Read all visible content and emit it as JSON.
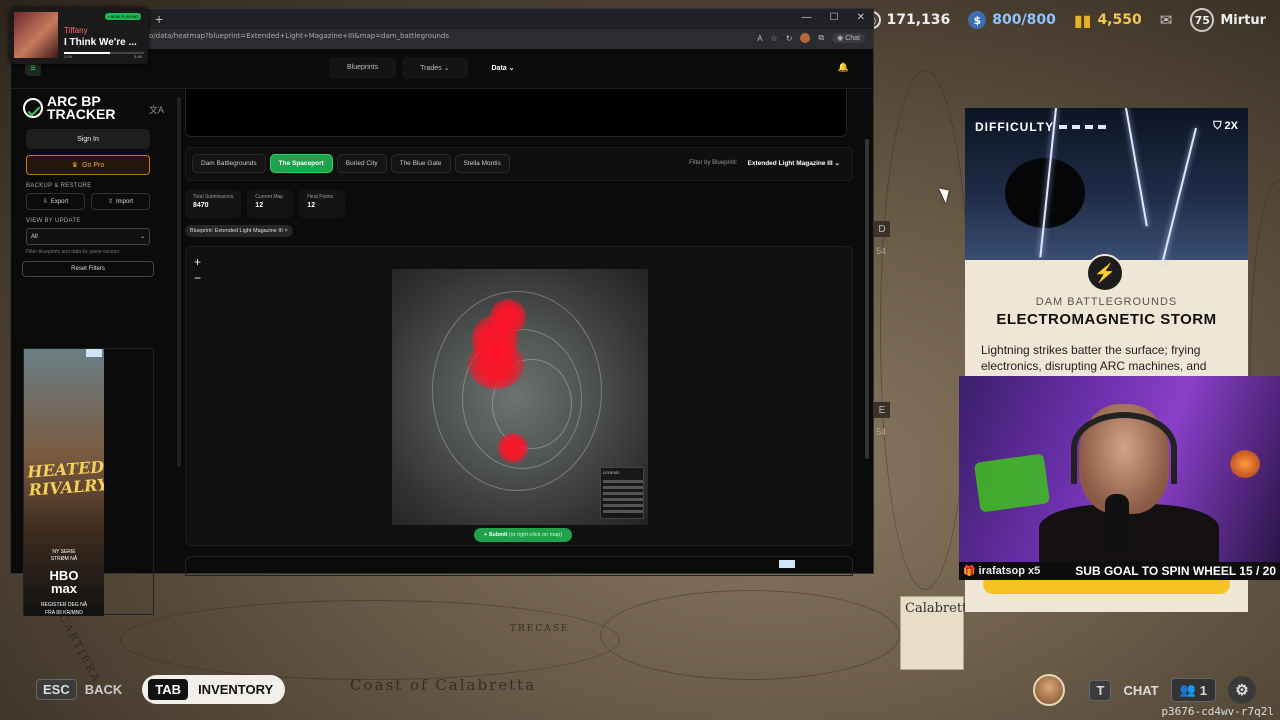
{
  "hud": {
    "currency1": "171,136",
    "currency2": "800/800",
    "currency3": "4,550",
    "level": "75",
    "username": "Mirtur",
    "esc_key": "ESC",
    "back_label": "BACK",
    "tab_key": "TAB",
    "inventory_label": "INVENTORY",
    "chat_key": "T",
    "chat_label": "CHAT",
    "party_count": "1",
    "watermark": "p3676-cd4wv-r7q2l"
  },
  "map_labels": {
    "coast": "Coast of Calabretta",
    "cartiera": "LA CARTIERA",
    "cabin": "TRECASE",
    "calabretta": "Calabretta"
  },
  "side_markers": {
    "d_letter": "D",
    "num1": "54",
    "e_letter": "E",
    "num2": "54"
  },
  "event": {
    "difficulty_label": "DIFFICULTY",
    "multiplier": "2X",
    "map": "DAM BATTLEGROUNDS",
    "title": "ELECTROMAGNETIC STORM",
    "description": "Lightning strikes batter the surface; frying electronics, disrupting ARC machines, and electrocuting unsuspecting Raiders."
  },
  "stream": {
    "gift_text": "irafatsop x5",
    "sub_goal": "SUB GOAL TO SPIN WHEEL 15 / 20"
  },
  "now_playing": {
    "badge": "• NOW PLAYING",
    "artist": "Tiffany",
    "title": "I Think We're ...",
    "elapsed": "2:09",
    "duration": "3:48",
    "progress": 0.57
  },
  "browser": {
    "url": "o/data/heatmap?blueprint=Extended+Light+Magazine+III&map=dam_battlegrounds",
    "chat_label": "Chat",
    "nav": [
      "Blueprints",
      "Trades",
      "Data"
    ],
    "sidebar": {
      "logo_line1": "ARC BP",
      "logo_line2": "TRACKER",
      "sign_in": "Sign In",
      "go_pro": "Go Pro",
      "backup_label": "BACKUP & RESTORE",
      "export": "Export",
      "import": "Import",
      "view_label": "VIEW BY UPDATE",
      "view_value": "All",
      "view_hint": "Filter blueprints and data by game version",
      "reset": "Reset Filters"
    },
    "ad": {
      "title": "HEATED RIVALRY",
      "sub1": "NY SERIE",
      "sub2": "STRØM NÅ",
      "brand1": "HBO",
      "brand2": "max",
      "cta1": "REGISTER DEG NÅ",
      "cta2": "FRA 89 KR/MND"
    },
    "map_tabs": [
      "Dam Battlegrounds",
      "The Spaceport",
      "Buried City",
      "The Blue Gate",
      "Stella Montis"
    ],
    "active_tab": "The Spaceport",
    "filter_label": "Filter by Blueprint:",
    "filter_value": "Extended Light Magazine III",
    "stats": [
      {
        "label": "Total Submissions",
        "value": "8470"
      },
      {
        "label": "Current Map",
        "value": "12"
      },
      {
        "label": "Heat Points",
        "value": "12"
      }
    ],
    "chip": "Blueprint: Extended Light Magazine III ×",
    "zoom_in": "+",
    "zoom_out": "−",
    "legend_title": "LEGEND",
    "submit_label": "Submit",
    "submit_hint": "(or right-click on map)"
  },
  "colors": {
    "accent_green": "#1fa24a",
    "pro_orange": "#c57620",
    "heat_red": "#ff1428",
    "event_yellow": "#f6c323"
  }
}
